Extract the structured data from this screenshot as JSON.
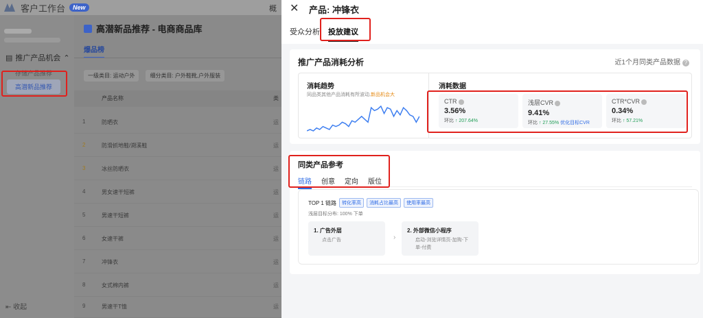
{
  "app": {
    "title": "客户工作台",
    "badge": "New",
    "topnav": "概"
  },
  "sidebar": {
    "section_label": "推广产品机会",
    "items": [
      {
        "label": "存储产品推荐"
      },
      {
        "label": "高潜新品推荐"
      }
    ],
    "collapse_label": "收起"
  },
  "main": {
    "title": "高潜新品推荐 - 电商商品库",
    "tab": "爆品榜",
    "filters": [
      "一级类目: 运动户外",
      "细分类目: 户外鞋靴,户外服装"
    ],
    "columns": {
      "name": "产品名称",
      "extra": "类"
    },
    "rows": [
      {
        "num": "1",
        "name": "防晒衣",
        "extra": "运"
      },
      {
        "num": "2",
        "name": "防滑抓地鞋/溯溪鞋",
        "extra": "运"
      },
      {
        "num": "3",
        "name": "冰丝防晒衣",
        "extra": "运"
      },
      {
        "num": "4",
        "name": "男女速干短裤",
        "extra": "运"
      },
      {
        "num": "5",
        "name": "男速干短裤",
        "extra": "运"
      },
      {
        "num": "6",
        "name": "女速干裤",
        "extra": "运"
      },
      {
        "num": "7",
        "name": "冲锋衣",
        "extra": "运"
      },
      {
        "num": "8",
        "name": "女式棉内裤",
        "extra": "运"
      },
      {
        "num": "9",
        "name": "男速干T恤",
        "extra": "运"
      }
    ]
  },
  "drawer": {
    "close_icon": "close-icon",
    "title": "产品: 冲锋衣",
    "tabs": [
      {
        "label": "受众分析"
      },
      {
        "label": "投放建议"
      }
    ],
    "consumption": {
      "title": "推广产品消耗分析",
      "right_note": "近1个月同类产品数据",
      "trend_title": "消耗趋势",
      "trend_sub": "同品类其他产品消耗有所波动,",
      "trend_highlight": "新品机会大",
      "data_title": "消耗数据",
      "metrics": [
        {
          "label": "CTR",
          "value": "3.56%",
          "change_prefix": "环比",
          "change": "↑ 207.64%",
          "link": ""
        },
        {
          "label": "浅层CVR",
          "value": "9.41%",
          "change_prefix": "环比",
          "change": "↑ 27.55%",
          "link": "优化目标CVR"
        },
        {
          "label": "CTR*CVR",
          "value": "0.34%",
          "change_prefix": "环比",
          "change": "↑ 57.21%",
          "link": ""
        }
      ],
      "trend_values": [
        30,
        31,
        30,
        32,
        31,
        33,
        32,
        31,
        34,
        33,
        34,
        36,
        35,
        33,
        37,
        36,
        38,
        40,
        38,
        36,
        46,
        44,
        45,
        47,
        42,
        46,
        45,
        40,
        44,
        41,
        46,
        44,
        41,
        40,
        36,
        40
      ]
    },
    "reference": {
      "title": "同类产品参考",
      "tabs": [
        {
          "label": "链路"
        },
        {
          "label": "创意"
        },
        {
          "label": "定向"
        },
        {
          "label": "版位"
        }
      ],
      "top_label": "TOP 1 链路",
      "tags": [
        "转化率高",
        "消耗占比最高",
        "使用率最高"
      ],
      "dist": "浅层目标分布: 100% 下单",
      "steps": [
        {
          "title": "1. 广告外层",
          "desc1": "点击广告",
          "desc2": ""
        },
        {
          "title": "2. 外部微信小程序",
          "desc1": "启动-浏览详情页-加购-下",
          "desc2": "单-付费"
        }
      ]
    }
  },
  "colors": {
    "accent": "#2f6ce5",
    "highlight": "#e58a14",
    "annotation": "#e0201c"
  }
}
